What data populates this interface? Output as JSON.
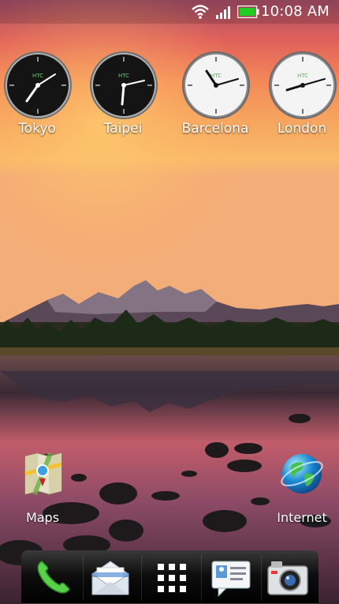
{
  "status_bar": {
    "time": "10:08 AM",
    "icons": [
      "wifi-icon",
      "signal-icon",
      "battery-icon"
    ],
    "battery_color": "#22cc22"
  },
  "clocks": [
    {
      "city": "Tokyo",
      "face": "dark",
      "brand": "HTC"
    },
    {
      "city": "Taipei",
      "face": "dark",
      "brand": "HTC"
    },
    {
      "city": "Barcelona",
      "face": "light",
      "brand": "HTC"
    },
    {
      "city": "London",
      "face": "light",
      "brand": "HTC"
    }
  ],
  "apps": [
    {
      "label": "Maps",
      "icon": "maps-icon"
    },
    {
      "label": "Internet",
      "icon": "globe-icon"
    }
  ],
  "dock": [
    "phone-icon",
    "mail-icon",
    "app-drawer-icon",
    "messages-icon",
    "camera-icon"
  ]
}
